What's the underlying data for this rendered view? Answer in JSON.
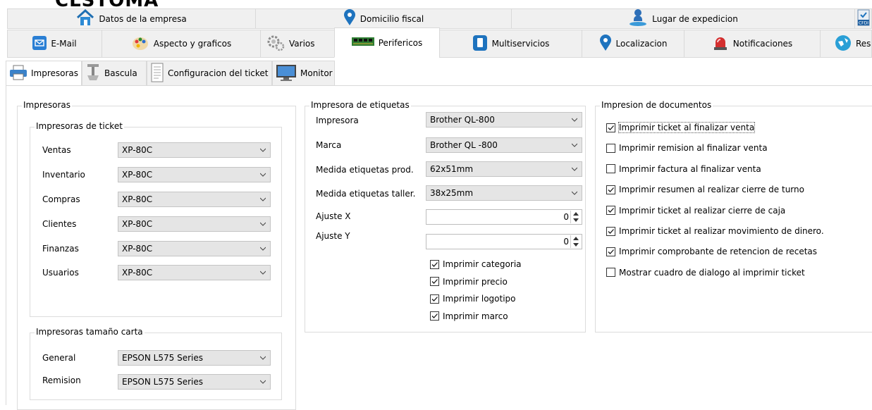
{
  "window": {
    "title_fragment": "CLSTOMA"
  },
  "tabs_row1": [
    {
      "label": "Datos de la empresa",
      "icon": "house-icon"
    },
    {
      "label": "Domicilio fiscal",
      "icon": "location-pin-icon"
    },
    {
      "label": "Lugar de expedicion",
      "icon": "person-location-icon"
    },
    {
      "label": "",
      "icon": "cfdi-icon",
      "icon_text": "CFDI"
    }
  ],
  "tabs_row2": [
    {
      "label": "E-Mail",
      "icon": "email-icon"
    },
    {
      "label": "Aspecto y graficos",
      "icon": "palette-icon"
    },
    {
      "label": "Varios",
      "icon": "gears-icon"
    },
    {
      "label": "Perifericos",
      "icon": "circuit-board-icon",
      "active": true
    },
    {
      "label": "Multiservicios",
      "icon": "phone-icon"
    },
    {
      "label": "Localizacion",
      "icon": "location-pin-icon"
    },
    {
      "label": "Notificaciones",
      "icon": "alarm-light-icon"
    },
    {
      "label": "Res",
      "icon": "globe-icon"
    }
  ],
  "subtabs": [
    {
      "label": "Impresoras",
      "icon": "printer-icon",
      "active": true
    },
    {
      "label": "Bascula",
      "icon": "scale-icon"
    },
    {
      "label": "Configuracion del ticket",
      "icon": "ticket-icon"
    },
    {
      "label": "Monitor",
      "icon": "monitor-icon"
    }
  ],
  "impresoras": {
    "title": "Impresoras",
    "ticket": {
      "title": "Impresoras de ticket",
      "rows": [
        {
          "label": "Ventas",
          "value": "XP-80C"
        },
        {
          "label": "Inventario",
          "value": "XP-80C"
        },
        {
          "label": "Compras",
          "value": "XP-80C"
        },
        {
          "label": "Clientes",
          "value": "XP-80C"
        },
        {
          "label": "Finanzas",
          "value": "XP-80C"
        },
        {
          "label": "Usuarios",
          "value": "XP-80C"
        }
      ]
    },
    "carta": {
      "title": "Impresoras tamaño carta",
      "rows": [
        {
          "label": "General",
          "value": "EPSON L575 Series"
        },
        {
          "label": "Remision",
          "value": "EPSON L575 Series"
        }
      ]
    }
  },
  "etiquetas": {
    "title": "Impresora de etiquetas",
    "impresora": {
      "label": "Impresora",
      "value": "Brother QL-800"
    },
    "marca": {
      "label": "Marca",
      "value": "Brother QL -800"
    },
    "medida_prod": {
      "label": "Medida etiquetas prod.",
      "value": "62x51mm"
    },
    "medida_taller": {
      "label": "Medida etiquetas taller.",
      "value": "38x25mm"
    },
    "ajuste_x": {
      "label": "Ajuste X",
      "value": "0"
    },
    "ajuste_y": {
      "label": "Ajuste Y",
      "value": "0"
    },
    "checks": [
      {
        "label": "Imprimir categoria",
        "checked": true
      },
      {
        "label": "Imprimir precio",
        "checked": true
      },
      {
        "label": "Imprimir logotipo",
        "checked": true
      },
      {
        "label": "Imprimir marco",
        "checked": true
      }
    ]
  },
  "documentos": {
    "title": "Impresion de documentos",
    "checks": [
      {
        "label": "Imprimir ticket al finalizar venta",
        "checked": true
      },
      {
        "label": "Imprimir remision al finalizar venta",
        "checked": false
      },
      {
        "label": "Imprimir factura al finalizar venta",
        "checked": false
      },
      {
        "label": "Imprimir resumen al realizar cierre de turno",
        "checked": true
      },
      {
        "label": "Imprimir ticket al realizar cierre de caja",
        "checked": true
      },
      {
        "label": "Imprimir ticket al realizar movimiento de dinero.",
        "checked": true
      },
      {
        "label": "Imprimir comprobante de retencion de recetas",
        "checked": true
      },
      {
        "label": "Mostrar cuadro de dialogo al imprimir ticket",
        "checked": false
      }
    ]
  },
  "colors": {
    "tab_bg": "#f0f0f0",
    "border": "#d9d9d9",
    "combo_bg": "#e5e5e5",
    "check_color": "#1a1a1a"
  }
}
